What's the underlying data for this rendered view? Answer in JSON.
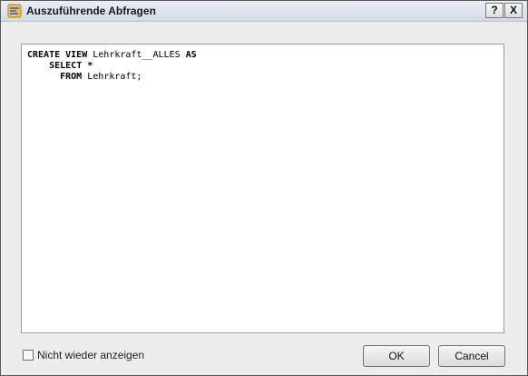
{
  "window": {
    "title": "Auszuführende Abfragen",
    "help_label": "?",
    "close_label": "X",
    "icon": "sql-query-icon"
  },
  "editor": {
    "line1_kw1": "CREATE VIEW",
    "line1_name": " Lehrkraft__ALLES ",
    "line1_kw2": "AS",
    "line2_indent": "    ",
    "line2_kw": "SELECT *",
    "line3_indent": "      ",
    "line3_kw": "FROM",
    "line3_rest": " Lehrkraft;"
  },
  "footer": {
    "checkbox_label": "Nicht wieder anzeigen",
    "checkbox_checked": false,
    "ok_label": "OK",
    "cancel_label": "Cancel"
  },
  "colors": {
    "titlebar": "#d2dbe8",
    "window_bg": "#ededed",
    "editor_bg": "#ffffff"
  }
}
